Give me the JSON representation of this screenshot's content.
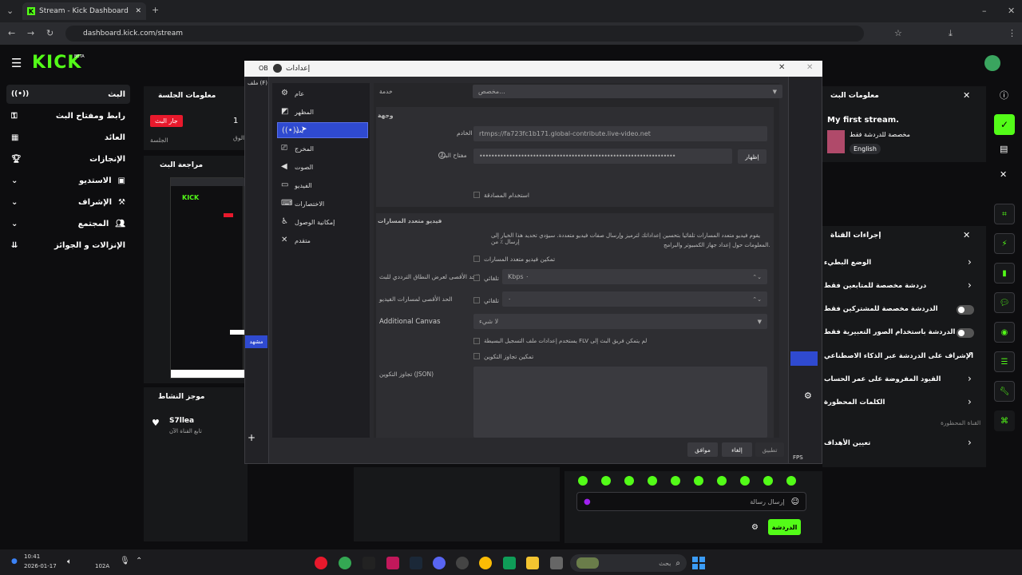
{
  "browser": {
    "tab_title": "Stream - Kick Dashboard",
    "url": "dashboard.kick.com/stream"
  },
  "brand": {
    "logo": "KICK",
    "beta": "BETA",
    "accent": "#53fc18"
  },
  "sidebar": {
    "items": [
      {
        "label": "البث"
      },
      {
        "label": "رابط ومفتاح البث"
      },
      {
        "label": "العائد"
      },
      {
        "label": "الإنجازات"
      },
      {
        "label": "الاستديو"
      },
      {
        "label": "الإشراف"
      },
      {
        "label": "المجتمع"
      },
      {
        "label": "الإنزالات و الجوائز"
      }
    ]
  },
  "session": {
    "title": "معلومات الجلسة",
    "badge": "جار البث",
    "count": "1",
    "sub_left": "الجلسة",
    "sub_right": "الوق"
  },
  "preview": {
    "title": "مراجعة البث"
  },
  "activity": {
    "title": "موجز النشاط",
    "user": "S7llea",
    "user_sub": "تابع القناة الآن"
  },
  "settings": {
    "title": "إعدادات",
    "bg_title": "OB",
    "file_menu": "ملف (F)",
    "nav": [
      {
        "label": "عام",
        "icon": "gear-icon"
      },
      {
        "label": "المظهر",
        "icon": "appearance-icon"
      },
      {
        "label": "بث",
        "icon": "broadcast-icon"
      },
      {
        "label": "المخرج",
        "icon": "output-icon"
      },
      {
        "label": "الصوت",
        "icon": "speaker-icon"
      },
      {
        "label": "الفيديو",
        "icon": "monitor-icon"
      },
      {
        "label": "الاختصارات",
        "icon": "keyboard-icon"
      },
      {
        "label": "إمكانية الوصول",
        "icon": "accessibility-icon"
      },
      {
        "label": "متقدم",
        "icon": "tools-icon"
      }
    ],
    "service_label": "خدمة",
    "service_value": "مخصص...",
    "destination_title": "وجهة",
    "server_label": "الخادم",
    "server_value": "rtmps://fa723fc1b171.global-contribute.live-video.net",
    "key_label": "مفتاح البث",
    "key_value": "••••••••••••••••••••••••••••••••••••••••••••••••••••••••••••••••••",
    "show_button": "إظهار",
    "auth_label": "استخدام المصادقة",
    "multitrack_title": "فيديو متعدد المسارات",
    "multitrack_desc_1": "يقوم فيديو متعدد المسارات تلقائيا بتحسين إعداداتك لترميز وإرسال صفات فيديو متعددة. سيؤدي تحديد هذا الخيار إلى إرسال ٪ من",
    "multitrack_desc_2": "المعلومات حول إعداد جهاز الكمبيوتر والبرامج.",
    "enable_multitrack": "تمكين فيديو متعدد المسارات",
    "max_bw_label": "الحد الأقصى لعرض النطاق الترددي للبث",
    "auto_label": "تلقائي",
    "bw_value": "Kbps ٠",
    "max_tracks_label": "الحد الأقصى لمسارات الفيديو",
    "tracks_value": "٠",
    "canvas_label": "Additional Canvas",
    "canvas_value": "لا شيء",
    "flv_label": "يستخدم إعدادات ملف التسجيل البسيطة FLV لم يتمكن فريق البث إلى",
    "override_label": "تمكين تجاوز التكوين",
    "override_json_label": "تجاوز التكوين (JSON)",
    "apply": "تطبيق",
    "cancel": "إلغاء",
    "ok": "موافق"
  },
  "stream_info": {
    "title": "معلومات البث",
    "stream_title": "My first stream.",
    "category": "مخصصة للدردشة فقط",
    "language": "English"
  },
  "channel_actions": {
    "title": "إجراءات القناة",
    "items": [
      {
        "label": "الوضع البطيء"
      },
      {
        "label": "دردشة مخصصة للمتابعين فقط"
      },
      {
        "label": "الدردشة مخصصة للمشتركين فقط"
      },
      {
        "label": "الدردشة باستخدام الصور التعبيرية فقط"
      },
      {
        "label": "الإشراف على الدردشة عبر الذكاء الاصطناعي"
      },
      {
        "label": "القيود المفروضة على عمر الحساب"
      },
      {
        "label": "الكلمات المحظورة"
      }
    ],
    "blocked_channels": "القناة المحظورة",
    "set_goals": "تعيين الأهداف"
  },
  "chat": {
    "placeholder": "إرسال رسالة",
    "send_button": "الدردشة"
  },
  "obs_bottom": {
    "fps": "FPS",
    "scene": "مشهد"
  },
  "taskbar": {
    "time": "10:41",
    "date": "2026-01-17",
    "temp": "102A",
    "search": "بحث"
  }
}
